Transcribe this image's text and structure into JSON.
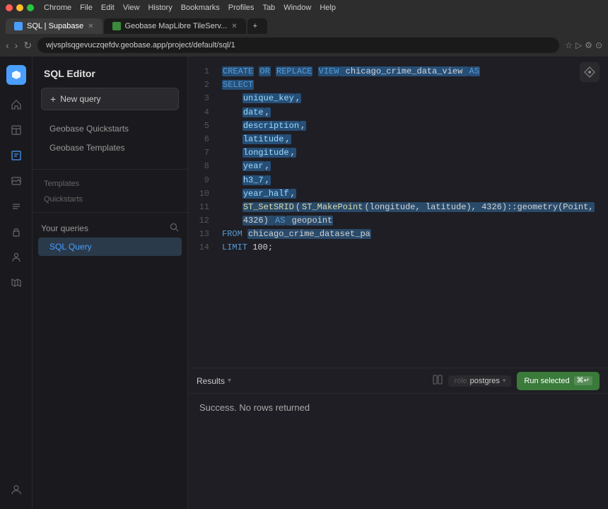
{
  "chrome": {
    "menu_items": [
      "Chrome",
      "File",
      "Edit",
      "View",
      "History",
      "Bookmarks",
      "Profiles",
      "Tab",
      "Window",
      "Help"
    ],
    "tab1_label": "SQL | Supabase",
    "tab2_label": "Geobase MapLibre TileServ...",
    "address": "wjvsplsqgevuczqefdv.geobase.app/project/default/sql/1"
  },
  "sidebar": {
    "title": "SQL Editor",
    "new_query_label": "New query",
    "items": [
      {
        "label": "Geobase Quickstarts",
        "id": "quickstarts"
      },
      {
        "label": "Geobase Templates",
        "id": "templates"
      }
    ],
    "templates_label": "Templates",
    "quickstarts_label": "Quickstarts",
    "your_queries_label": "Your queries",
    "active_query": "SQL Query"
  },
  "editor": {
    "lines": [
      {
        "num": "1",
        "content": "CREATE OR REPLACE VIEW chicago_crime_data_view AS"
      },
      {
        "num": "2",
        "content": "SELECT"
      },
      {
        "num": "3",
        "content": "    unique_key,"
      },
      {
        "num": "4",
        "content": "    date,"
      },
      {
        "num": "5",
        "content": "    description,"
      },
      {
        "num": "6",
        "content": "    latitude,"
      },
      {
        "num": "7",
        "content": "    longitude,"
      },
      {
        "num": "8",
        "content": "    year,"
      },
      {
        "num": "9",
        "content": "    h3_7,"
      },
      {
        "num": "10",
        "content": "    year_half,"
      },
      {
        "num": "11",
        "content": "    ST_SetSRID(ST_MakePoint(longitude, latitude), 4326)::geometry(Point,"
      },
      {
        "num": "12",
        "content": "    4326) AS geopoint"
      },
      {
        "num": "13",
        "content": "FROM chicago_crime_dataset_pa"
      },
      {
        "num": "14",
        "content": "LIMIT 100;"
      }
    ]
  },
  "results": {
    "tab_label": "Results",
    "role_label": "role",
    "role_value": "postgres",
    "run_button_label": "Run selected",
    "run_button_kbd": "⌘↵",
    "success_message": "Success. No rows returned"
  },
  "icons": {
    "logo": "◈",
    "home": "⌂",
    "table": "▦",
    "image": "▣",
    "list": "≡",
    "lock": "🔒",
    "person": "◉",
    "map": "◫",
    "user_bottom": "◉",
    "search": "⌕",
    "plus": "+",
    "diamond": "◈",
    "columns": "⋮⋮"
  }
}
